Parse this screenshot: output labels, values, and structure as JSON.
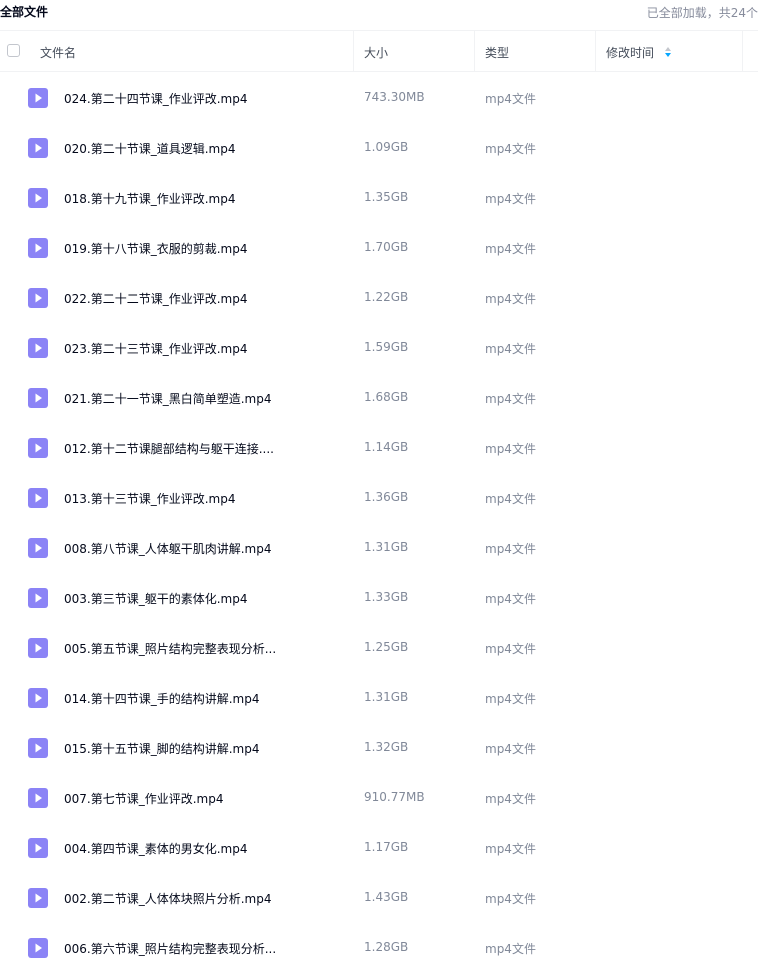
{
  "top": {
    "title": "全部文件",
    "status": "已全部加载，共24个"
  },
  "header": {
    "col_name": "文件名",
    "col_size": "大小",
    "col_type": "类型",
    "col_modified": "修改时间"
  },
  "colors": {
    "file_icon": "#8b83f6",
    "sort_active": "#06a7ff"
  },
  "files": [
    {
      "name": "024.第二十四节课_作业评改.mp4",
      "size": "743.30MB",
      "type": "mp4文件"
    },
    {
      "name": "020.第二十节课_道具逻辑.mp4",
      "size": "1.09GB",
      "type": "mp4文件"
    },
    {
      "name": "018.第十九节课_作业评改.mp4",
      "size": "1.35GB",
      "type": "mp4文件"
    },
    {
      "name": "019.第十八节课_衣服的剪裁.mp4",
      "size": "1.70GB",
      "type": "mp4文件"
    },
    {
      "name": "022.第二十二节课_作业评改.mp4",
      "size": "1.22GB",
      "type": "mp4文件"
    },
    {
      "name": "023.第二十三节课_作业评改.mp4",
      "size": "1.59GB",
      "type": "mp4文件"
    },
    {
      "name": "021.第二十一节课_黑白简单塑造.mp4",
      "size": "1.68GB",
      "type": "mp4文件"
    },
    {
      "name": "012.第十二节课腿部结构与躯干连接....",
      "size": "1.14GB",
      "type": "mp4文件"
    },
    {
      "name": "013.第十三节课_作业评改.mp4",
      "size": "1.36GB",
      "type": "mp4文件"
    },
    {
      "name": "008.第八节课_人体躯干肌肉讲解.mp4",
      "size": "1.31GB",
      "type": "mp4文件"
    },
    {
      "name": "003.第三节课_躯干的素体化.mp4",
      "size": "1.33GB",
      "type": "mp4文件"
    },
    {
      "name": "005.第五节课_照片结构完整表现分析...",
      "size": "1.25GB",
      "type": "mp4文件"
    },
    {
      "name": "014.第十四节课_手的结构讲解.mp4",
      "size": "1.31GB",
      "type": "mp4文件"
    },
    {
      "name": "015.第十五节课_脚的结构讲解.mp4",
      "size": "1.32GB",
      "type": "mp4文件"
    },
    {
      "name": "007.第七节课_作业评改.mp4",
      "size": "910.77MB",
      "type": "mp4文件"
    },
    {
      "name": "004.第四节课_素体的男女化.mp4",
      "size": "1.17GB",
      "type": "mp4文件"
    },
    {
      "name": "002.第二节课_人体体块照片分析.mp4",
      "size": "1.43GB",
      "type": "mp4文件"
    },
    {
      "name": "006.第六节课_照片结构完整表现分析...",
      "size": "1.28GB",
      "type": "mp4文件"
    }
  ]
}
